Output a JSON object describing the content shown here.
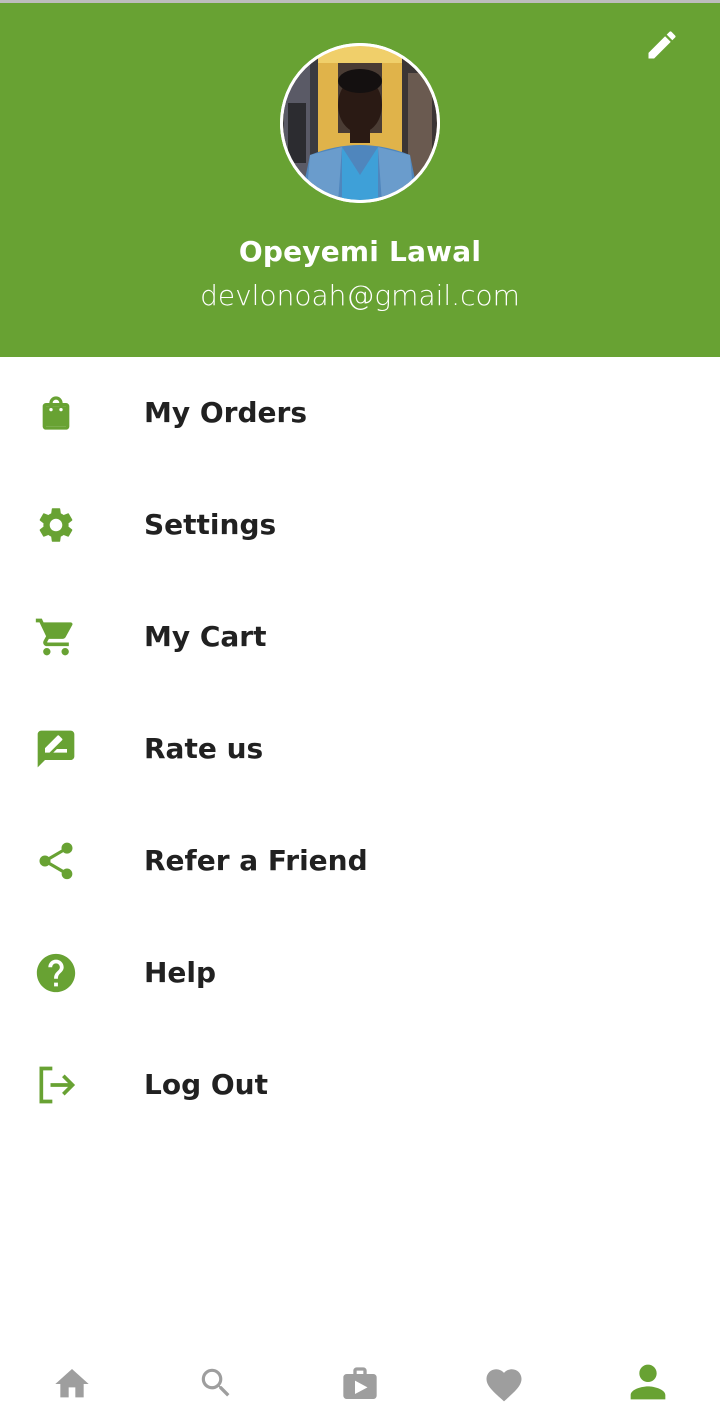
{
  "colors": {
    "brand_green": "#68a233",
    "menu_text": "#212121",
    "nav_inactive": "#9e9e9e",
    "nav_active": "#68a233",
    "header_text": "#ffffff"
  },
  "header": {
    "edit_icon": "pencil-icon",
    "avatar_icon": "profile-photo",
    "name": "Opeyemi Lawal",
    "email": "devlonoah@gmail.com"
  },
  "menu": {
    "items": [
      {
        "label": "My Orders",
        "icon": "shopping-bag-icon"
      },
      {
        "label": "Settings",
        "icon": "gear-icon"
      },
      {
        "label": "My Cart",
        "icon": "cart-icon"
      },
      {
        "label": "Rate us",
        "icon": "rate-review-icon"
      },
      {
        "label": "Refer a Friend",
        "icon": "share-icon"
      },
      {
        "label": "Help",
        "icon": "help-icon"
      },
      {
        "label": "Log Out",
        "icon": "logout-icon"
      }
    ]
  },
  "bottom_nav": {
    "items": [
      {
        "icon": "home-icon",
        "active": false
      },
      {
        "icon": "search-icon",
        "active": false
      },
      {
        "icon": "store-icon",
        "active": false
      },
      {
        "icon": "heart-icon",
        "active": false
      },
      {
        "icon": "person-icon",
        "active": true
      }
    ]
  }
}
